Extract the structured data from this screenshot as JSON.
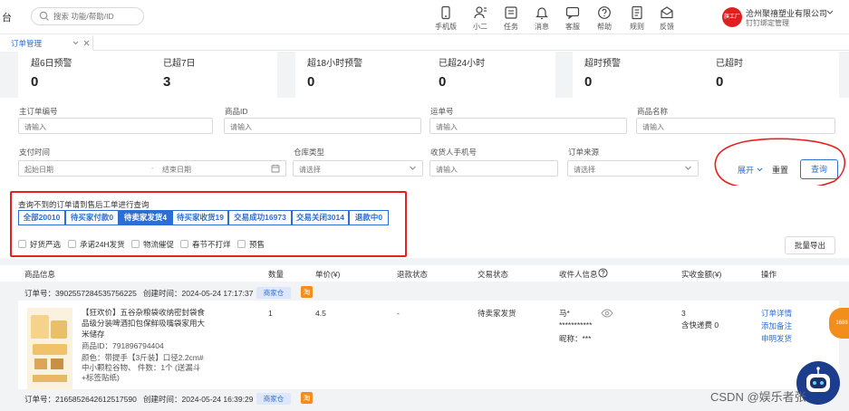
{
  "topbar": {
    "brand_fragment": "台",
    "search_placeholder": "搜索 功能/帮助/ID",
    "tools": [
      {
        "label": "手机版",
        "icon": "phone-icon"
      },
      {
        "label": "小二",
        "icon": "person-icon"
      },
      {
        "label": "任务",
        "icon": "task-icon"
      },
      {
        "label": "消息",
        "icon": "bell-icon"
      },
      {
        "label": "客服",
        "icon": "chat-icon"
      },
      {
        "label": "帮助",
        "icon": "help-icon"
      },
      {
        "label": "规则",
        "icon": "rules-icon"
      },
      {
        "label": "反馈",
        "icon": "feedback-icon"
      }
    ],
    "shop_logo_text": "旗工厂",
    "shop_name": "沧州聚禧塑业有限公司",
    "shop_sub": "钉钉绑定管理"
  },
  "tabs": {
    "active": "订单管理"
  },
  "warnings": [
    {
      "label": "超6日预警",
      "value": "0"
    },
    {
      "label": "已超7日",
      "value": "3"
    },
    {
      "label": "超18小时预警",
      "value": "0"
    },
    {
      "label": "已超24小时",
      "value": "0"
    },
    {
      "label": "超时预警",
      "value": "0"
    },
    {
      "label": "已超时",
      "value": "0"
    }
  ],
  "filters": {
    "main_order": {
      "label": "主订单编号",
      "placeholder": "请输入"
    },
    "product_id": {
      "label": "商品ID",
      "placeholder": "请输入"
    },
    "waybill": {
      "label": "运单号",
      "placeholder": "请输入"
    },
    "product_name": {
      "label": "商品名称",
      "placeholder": "请输入"
    },
    "pay_time": {
      "label": "支付时间",
      "start": "起始日期",
      "end": "结束日期",
      "sep": "-"
    },
    "warehouse": {
      "label": "仓库类型",
      "placeholder": "请选择"
    },
    "receiver_phone": {
      "label": "收货人手机号",
      "placeholder": "请输入"
    },
    "order_source": {
      "label": "订单来源",
      "placeholder": "请选择"
    },
    "expand": "展开",
    "reset": "重置",
    "query": "查询"
  },
  "status": {
    "hint": "查询不到的订单请到售后工单进行查询",
    "tabs": [
      "全部20010",
      "待买家付款0",
      "待卖家发货4",
      "待买家收货19",
      "交易成功16973",
      "交易关闭3014",
      "退款中0"
    ],
    "active_index": 2,
    "checkboxes": [
      "好货严选",
      "承诺24H发货",
      "物流催促",
      "春节不打烊",
      "预售"
    ],
    "export": "批量导出"
  },
  "table": {
    "headers": [
      "商品信息",
      "数量",
      "单价(¥)",
      "退款状态",
      "交易状态",
      "收件人信息",
      "实收金额(¥)",
      "操作"
    ]
  },
  "orders": [
    {
      "order_no_label": "订单号：",
      "order_no": "3902557284535756225",
      "created_label": "创建时间：",
      "created": "2024-05-24 17:17:37",
      "shop_badge": "商家仓",
      "tao_badge": "淘",
      "title_line1": "【狂欢价】五谷杂粮袋收纳密封袋食",
      "title_line2": "品级分装啤酒扣包保鲜吸嘴袋家用大",
      "title_line3": "米储存",
      "product_id": "商品ID：791896794404",
      "spec_line1": "颜色：带提手【3斤装】口径2.2cm#",
      "spec_line2": "中小颗粒谷物、 件数：1个 (送漏斗",
      "spec_line3": "+标签贴纸)",
      "qty": "1",
      "price": "4.5",
      "refund": "-",
      "trade_status": "待卖家发货",
      "receiver_name": "马*",
      "receiver_phone": "***********",
      "receiver_nick": "昵称：***",
      "amount": "3",
      "shipping": "含快递费 0",
      "actions": [
        "订单详情",
        "添加备注",
        "申明发货"
      ]
    },
    {
      "order_no_label": "订单号：",
      "order_no": "2165852642612517590",
      "created_label": "创建时间：",
      "created": "2024-05-24 16:39:29",
      "shop_badge": "商家仓",
      "tao_badge": "淘"
    }
  ],
  "side_badge": "1688",
  "watermark": "CSDN @娱乐者张",
  "colors": {
    "accent": "#2b6fd6",
    "highlight": "#e8201e",
    "tao": "#f38d1c"
  }
}
